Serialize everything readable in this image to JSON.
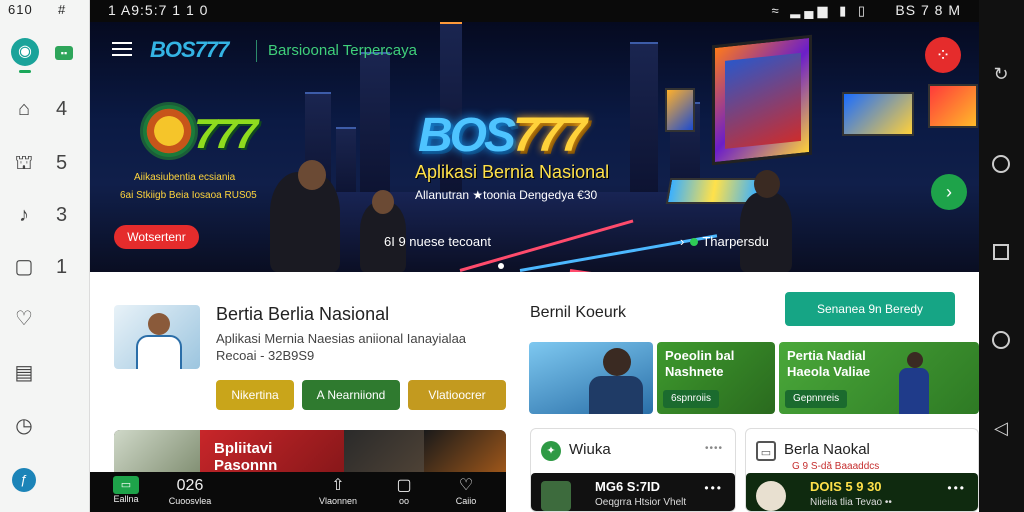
{
  "system": {
    "left_status": "610",
    "left_status2": "#",
    "top_left": "1   A9:5:7 1 1 0",
    "top_right": "BS 7 8 M",
    "status_icons": "≈ ▂▄▆ ▮ ▯"
  },
  "rail": {
    "items": [
      {
        "icon": "home-icon",
        "glyph": "⌂",
        "count": "4"
      },
      {
        "icon": "bank-icon",
        "glyph": "⛫",
        "count": "5"
      },
      {
        "icon": "music-icon",
        "glyph": "♪",
        "count": "3"
      },
      {
        "icon": "message-icon",
        "glyph": "▢",
        "count": "1"
      },
      {
        "icon": "location-icon",
        "glyph": "♡",
        "count": ""
      },
      {
        "icon": "document-icon",
        "glyph": "▤",
        "count": ""
      },
      {
        "icon": "clock-icon",
        "glyph": "◷",
        "count": ""
      }
    ]
  },
  "header": {
    "brand": "BOS777",
    "tagline": "Barsioonal Terpercaya"
  },
  "hero": {
    "logo_number": "777",
    "left_sub1": "Aiikasiubentia ecsiania",
    "left_sub2": "6ai Stkiigb Beia Iosaoa RUS05",
    "cta_label": "Wotsertenr",
    "big_logo_a": "BOS",
    "big_logo_b": "777",
    "title": "Aplikasi Bernia Nasional",
    "subtitle": "Allanutran ★toonia Dengedya €30",
    "foot_left": "6I 9 nuese tecoant",
    "foot_right": "Tharpersdu"
  },
  "news": {
    "title": "Bertia Berlia Nasional",
    "desc_line1": "Aplikasi Mernia Naesias aniional Ianayialaa",
    "desc_line2": "Recoai - 32B9S9",
    "tags": [
      {
        "label": "Nikertina",
        "color": "#c9a51a"
      },
      {
        "label": "A  Nearniiond",
        "color": "#2f7a2f"
      },
      {
        "label": "Vlatioocrer",
        "color": "#c39a1f"
      }
    ]
  },
  "promo_strip": {
    "label_line1": "Bpliitavi",
    "label_line2": "Pasonnn"
  },
  "right_panel": {
    "title": "Bernil Koeurk",
    "action_label": "Senanea 9n Beredy",
    "promos": [
      {
        "line1": "",
        "line2": "",
        "chip": ""
      },
      {
        "line1": "Poeolin bal",
        "line2": "Nashnete",
        "chip": "6spnroiis"
      },
      {
        "line1": "Pertia Nadial",
        "line2": "Haeola Valiae",
        "chip": "Gepnnreis"
      }
    ],
    "cards": [
      {
        "title": "Wiuka",
        "dots": "••••",
        "sub": "",
        "dark_title": "MG6 S:7ID",
        "dark_sub": "Oeqgrra Htsior Vhelt",
        "dark_dots": "•••"
      },
      {
        "title": "Berla Naokal",
        "dots": "",
        "sub": "G 9 S-dă Baaaddcs",
        "dark_title": "DOIS 5 9 30",
        "dark_sub": "Niieiia tlia Tevao ••",
        "dark_dots": "•••"
      }
    ]
  },
  "bottom_nav": {
    "items": [
      {
        "label": "Eallna",
        "icon": "wallet-icon",
        "glyph": "▭"
      },
      {
        "label": "Cuoosvlea",
        "icon": "score-icon",
        "glyph": "026"
      },
      {
        "label": "Vlaonnen",
        "icon": "upload-icon",
        "glyph": "⇧"
      },
      {
        "label": "oo",
        "icon": "square-icon",
        "glyph": "▢"
      },
      {
        "label": "Caiio",
        "icon": "heart-icon",
        "glyph": "♡"
      }
    ]
  },
  "colors": {
    "accent_green": "#16a585",
    "brand_blue": "#34b4e4",
    "danger_red": "#e52c2c"
  }
}
